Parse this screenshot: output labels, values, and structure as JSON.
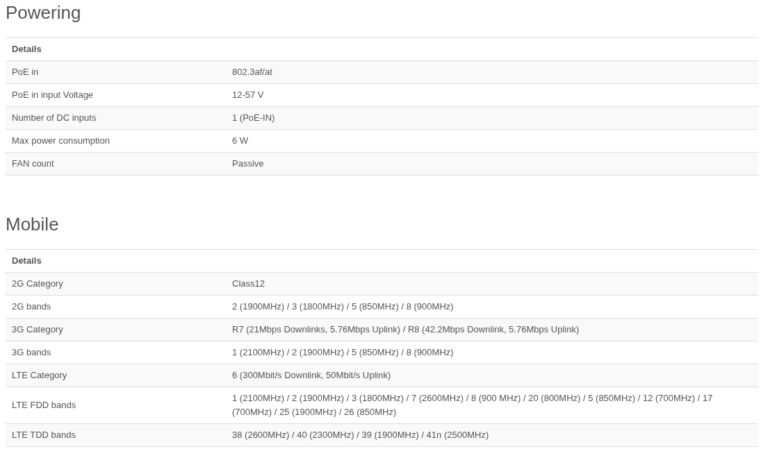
{
  "sections": [
    {
      "title": "Powering",
      "header": "Details",
      "rows": [
        {
          "label": "PoE in",
          "value": "802.3af/at"
        },
        {
          "label": "PoE in input Voltage",
          "value": "12-57 V"
        },
        {
          "label": "Number of DC inputs",
          "value": "1 (PoE-IN)"
        },
        {
          "label": "Max power consumption",
          "value": "6 W"
        },
        {
          "label": "FAN count",
          "value": "Passive"
        }
      ]
    },
    {
      "title": "Mobile",
      "header": "Details",
      "rows": [
        {
          "label": "2G Category",
          "value": "Class12"
        },
        {
          "label": "2G bands",
          "value": "2 (1900MHz) / 3 (1800MHz) / 5 (850MHz) / 8 (900MHz)"
        },
        {
          "label": "3G Category",
          "value": "R7 (21Mbps Downlinks, 5.76Mbps Uplink) / R8 (42.2Mbps Downlink, 5.76Mbps Uplink)"
        },
        {
          "label": "3G bands",
          "value": "1 (2100MHz) / 2 (1900MHz) / 5 (850MHz) / 8 (900MHz)"
        },
        {
          "label": "LTE Category",
          "value": "6 (300Mbit/s Downlink, 50Mbit/s Uplink)"
        },
        {
          "label": "LTE FDD bands",
          "value": "1 (2100MHz) / 2 (1900MHz) / 3 (1800MHz) / 7 (2600MHz) / 8 (900 MHz) / 20 (800MHz) / 5 (850MHz) / 12 (700MHz) / 17 (700MHz) / 25 (1900MHz) / 26 (850MHz)"
        },
        {
          "label": "LTE TDD bands",
          "value": "38 (2600MHz) / 40 (2300MHz) / 39 (1900MHz) / 41n (2500MHz)"
        }
      ]
    }
  ]
}
